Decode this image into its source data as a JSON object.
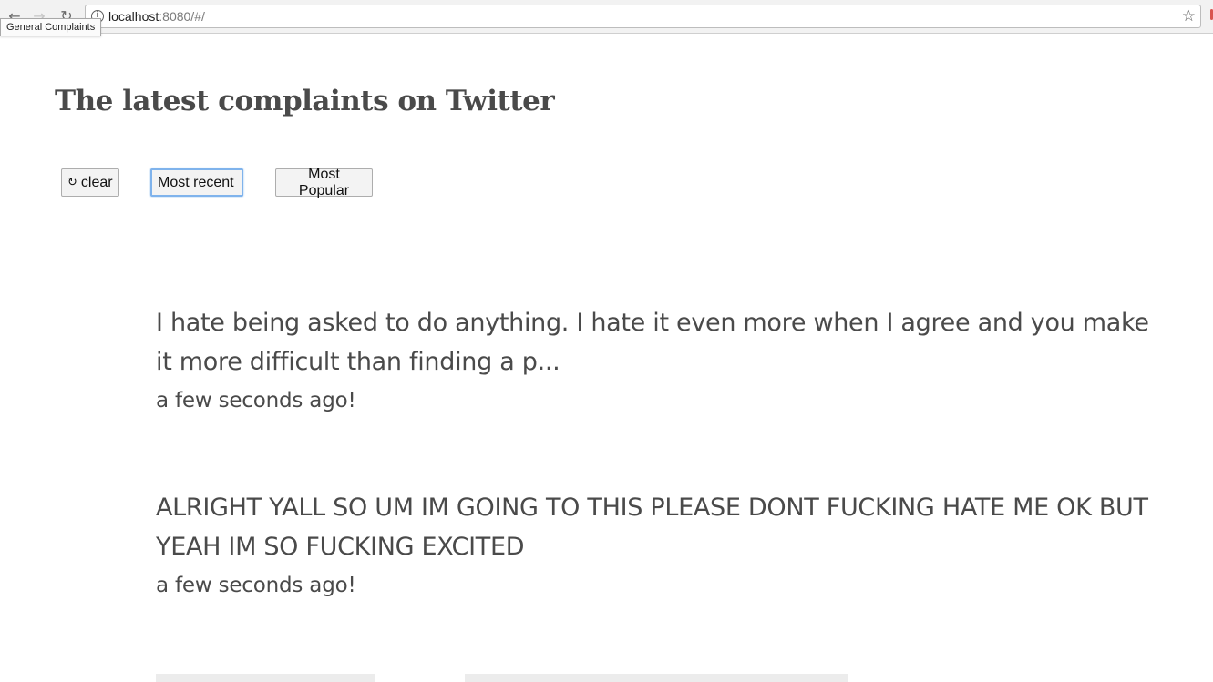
{
  "browser": {
    "url_host": "localhost",
    "url_rest": ":8080/#/",
    "tooltip": "General Complaints"
  },
  "page": {
    "title": "The latest complaints on Twitter"
  },
  "toolbar": {
    "clear_label": "clear",
    "recent_label": "Most recent",
    "popular_label": "Most Popular"
  },
  "tweets": [
    {
      "text": "I hate being asked to do anything. I hate it even more when I agree and you make it more difficult than finding a p...",
      "time": "a few seconds ago!"
    },
    {
      "text": "ALRIGHT YALL SO UM IM GOING TO THIS PLEASE DONT FUCKING HATE ME OK BUT YEAH IM SO FUCKING EXCITED",
      "time": "a few seconds ago!"
    }
  ],
  "icons": {
    "back": "arrow-left-icon",
    "forward": "arrow-right-icon",
    "reload": "reload-icon",
    "info": "info-icon",
    "bookmark": "star-icon",
    "refresh": "refresh-icon"
  }
}
